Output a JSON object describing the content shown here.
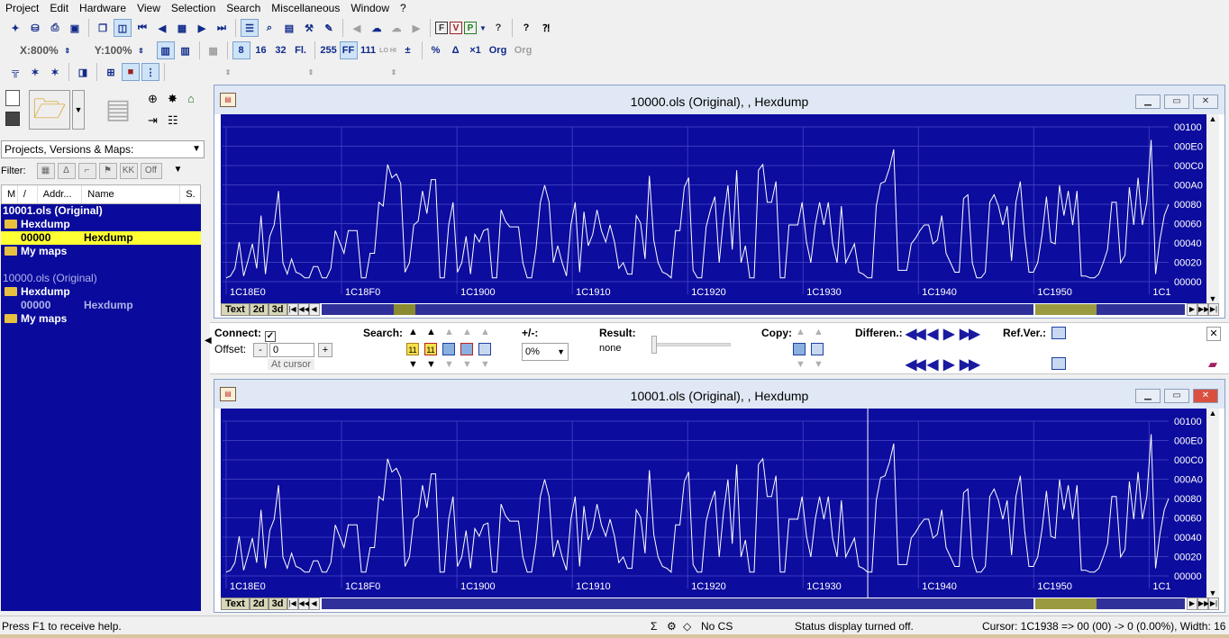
{
  "menu": [
    "Project",
    "Edit",
    "Hardware",
    "View",
    "Selection",
    "Search",
    "Miscellaneous",
    "Window",
    "?"
  ],
  "toolbar": {
    "zoom_x": "X:800%",
    "zoom_y": "Y:100%",
    "btn_8": "8",
    "btn_16": "16",
    "btn_32": "32",
    "btn_fl": "Fl.",
    "btn_255": "255",
    "btn_ff": "FF",
    "btn_111": "111",
    "btn_lohi": "LO HI",
    "btn_percent": "%",
    "btn_x1": "×1",
    "btn_org": "Org",
    "btn_org2": "Org",
    "btn_help": "?",
    "btn_f": "F",
    "btn_v": "V",
    "btn_p": "P",
    "btn_q": "?"
  },
  "left": {
    "project_select": "Projects, Versions & Maps:",
    "filter_label": "Filter:",
    "filter_off": "Off",
    "filter_kk": "KK",
    "columns": [
      "M",
      "/",
      "Addr...",
      "Name",
      "S."
    ],
    "tree": [
      {
        "label": "10001.ols (Original)",
        "style": "bold"
      },
      {
        "label": "Hexdump",
        "style": "folder"
      },
      {
        "addr": "00000",
        "name": "Hexdump",
        "style": "selected"
      },
      {
        "label": "My maps",
        "style": "folder"
      },
      {
        "label": "",
        "style": "spacer"
      },
      {
        "label": "10000.ols (Original)",
        "style": "dim"
      },
      {
        "label": "Hexdump",
        "style": "folder"
      },
      {
        "addr": "00000",
        "name": "Hexdump",
        "style": "dimrow"
      },
      {
        "label": "My maps",
        "style": "folder"
      }
    ]
  },
  "windows": [
    {
      "title": "10000.ols (Original), , Hexdump",
      "y_labels": [
        "00100",
        "000E0",
        "000C0",
        "000A0",
        "00080",
        "00060",
        "00040",
        "00020",
        "00000"
      ],
      "x_labels": [
        "1C18E0",
        "1C18F0",
        "1C1900",
        "1C1910",
        "1C1920",
        "1C1930",
        "1C1940",
        "1C1950",
        "1C1"
      ],
      "tab_text": "Text",
      "tab_2d": "2d",
      "tab_3d": "3d",
      "values": [
        4,
        6,
        14,
        42,
        6,
        22,
        40,
        14,
        70,
        8,
        48,
        60,
        96,
        20,
        8,
        24,
        10,
        8,
        4,
        4,
        16,
        16,
        4,
        4,
        14,
        54,
        42,
        30,
        54,
        54,
        54,
        4,
        4,
        30,
        30,
        84,
        80,
        124,
        110,
        114,
        104,
        10,
        20,
        60,
        64,
        96,
        72,
        108,
        108,
        4,
        4,
        60,
        84,
        10,
        20,
        48,
        8,
        50,
        42,
        54,
        56,
        4,
        4,
        76,
        64,
        58,
        58,
        58,
        20,
        4,
        4,
        34,
        84,
        102,
        84,
        20,
        38,
        20,
        6,
        60,
        84,
        10,
        74,
        38,
        50,
        76,
        54,
        42,
        60,
        42,
        14,
        20,
        8,
        8,
        70,
        62,
        24,
        112,
        44,
        20,
        10,
        8,
        4,
        54,
        54,
        100,
        110,
        12,
        4,
        4,
        58,
        76,
        90,
        20,
        68,
        102,
        34,
        118,
        20,
        38,
        4,
        4,
        118,
        124,
        84,
        84,
        106,
        4,
        4,
        60,
        60,
        60,
        84,
        42,
        20,
        60,
        84,
        60,
        84,
        40,
        20,
        80,
        20,
        30,
        40,
        10,
        8,
        4,
        4,
        80,
        104,
        106,
        120,
        140,
        12,
        12,
        12,
        40,
        46,
        54,
        60,
        60,
        40,
        44,
        70,
        30,
        20,
        10,
        10,
        88,
        92,
        20,
        4,
        4,
        10,
        84,
        92,
        80,
        60,
        80,
        22,
        84,
        106,
        48,
        10,
        10,
        20,
        50,
        90,
        42,
        40,
        102,
        70,
        96,
        60,
        96,
        6,
        6,
        4,
        4,
        8,
        20,
        34,
        84,
        84,
        20,
        28,
        100,
        60,
        110,
        60,
        84,
        150,
        8,
        44,
        70,
        82
      ]
    },
    {
      "title": "10001.ols (Original), , Hexdump",
      "y_labels": [
        "00100",
        "000E0",
        "000C0",
        "000A0",
        "00080",
        "00060",
        "00040",
        "00020",
        "00000"
      ],
      "x_labels": [
        "1C18E0",
        "1C18F0",
        "1C1900",
        "1C1910",
        "1C1920",
        "1C1930",
        "1C1940",
        "1C1950",
        "1C1"
      ],
      "tab_text": "Text",
      "tab_2d": "2d",
      "tab_3d": "3d",
      "values": [
        4,
        6,
        14,
        42,
        6,
        22,
        40,
        14,
        70,
        8,
        48,
        60,
        96,
        20,
        8,
        24,
        10,
        8,
        4,
        4,
        16,
        16,
        4,
        4,
        14,
        54,
        42,
        30,
        54,
        54,
        54,
        4,
        4,
        30,
        30,
        84,
        80,
        124,
        110,
        114,
        104,
        10,
        20,
        60,
        64,
        96,
        72,
        108,
        108,
        4,
        4,
        60,
        84,
        10,
        20,
        48,
        8,
        50,
        42,
        54,
        56,
        4,
        4,
        76,
        64,
        58,
        58,
        58,
        20,
        4,
        4,
        34,
        84,
        102,
        84,
        20,
        38,
        20,
        6,
        60,
        84,
        10,
        74,
        38,
        50,
        76,
        54,
        42,
        60,
        42,
        14,
        20,
        8,
        8,
        70,
        62,
        24,
        112,
        44,
        20,
        10,
        8,
        4,
        54,
        54,
        100,
        110,
        12,
        4,
        4,
        58,
        76,
        90,
        20,
        68,
        102,
        34,
        118,
        20,
        38,
        4,
        4,
        118,
        124,
        84,
        84,
        106,
        4,
        4,
        60,
        60,
        60,
        84,
        42,
        20,
        60,
        84,
        60,
        84,
        40,
        20,
        80,
        20,
        30,
        40,
        10,
        8,
        4,
        4,
        80,
        104,
        106,
        120,
        140,
        12,
        12,
        12,
        40,
        46,
        54,
        60,
        60,
        40,
        44,
        70,
        30,
        20,
        10,
        10,
        88,
        92,
        20,
        4,
        4,
        10,
        84,
        92,
        80,
        60,
        80,
        22,
        84,
        106,
        48,
        10,
        10,
        20,
        50,
        90,
        42,
        40,
        102,
        70,
        96,
        60,
        96,
        6,
        6,
        4,
        4,
        8,
        20,
        34,
        84,
        84,
        20,
        28,
        100,
        60,
        110,
        60,
        84,
        150,
        8,
        44,
        70,
        82
      ]
    }
  ],
  "search": {
    "connect_label": "Connect:",
    "offset_label": "Offset:",
    "offset_value": "0",
    "minus": "-",
    "plus": "+",
    "at_cursor": "At cursor",
    "search_label": "Search:",
    "plusminus_label": "+/-:",
    "plusminus_value": "0%",
    "result_label": "Result:",
    "result_value": "none",
    "copy_label": "Copy:",
    "differences_label": "Differen.:",
    "refver_label": "Ref.Ver.:",
    "badge_11": "11"
  },
  "status": {
    "help": "Press F1 to receive help.",
    "cs": "No CS",
    "display": "Status display turned off.",
    "cursor": "Cursor: 1C1938 => 00 (00) -> 0 (0.00%), Width: 16"
  },
  "colors": {
    "plot_bg": "#0c0c9e",
    "tree_bg": "#0a0a9c",
    "selection": "#ffff33"
  }
}
